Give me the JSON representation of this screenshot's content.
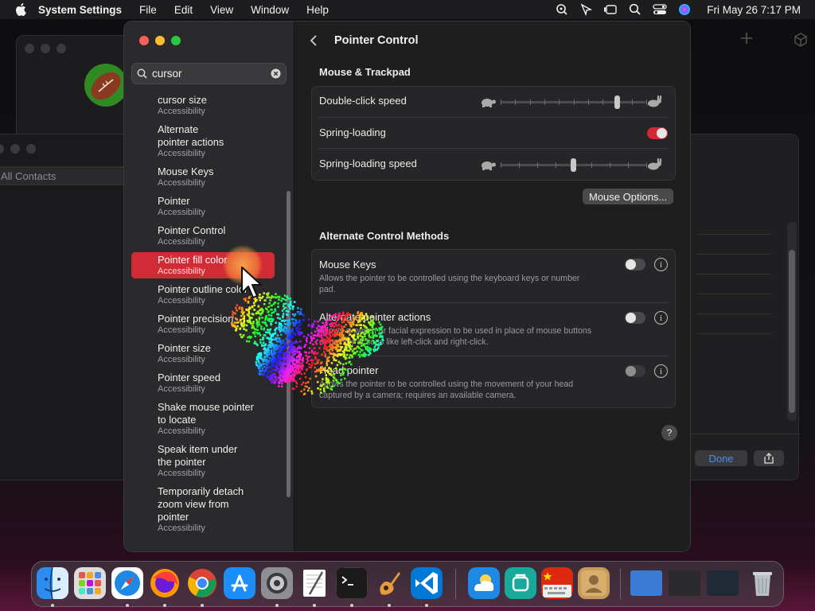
{
  "menubar": {
    "app": "System Settings",
    "menus": [
      "File",
      "Edit",
      "View",
      "Window",
      "Help"
    ],
    "clock": "Fri May 26  7:17 PM"
  },
  "background": {
    "contacts_label": "All Contacts",
    "done_label": "Done"
  },
  "search": {
    "value": "cursor",
    "placeholder": "Search"
  },
  "results": [
    {
      "title": [
        "cursor size"
      ],
      "sub": "Accessibility"
    },
    {
      "title": [
        "Alternate",
        "pointer actions"
      ],
      "sub": "Accessibility"
    },
    {
      "title": [
        "Mouse Keys"
      ],
      "sub": "Accessibility"
    },
    {
      "title": [
        "Pointer"
      ],
      "sub": "Accessibility"
    },
    {
      "title": [
        "Pointer Control"
      ],
      "sub": "Accessibility"
    },
    {
      "title": [
        "Pointer fill color"
      ],
      "sub": "Accessibility",
      "selected": true
    },
    {
      "title": [
        "Pointer outline color"
      ],
      "sub": "Accessibility"
    },
    {
      "title": [
        "Pointer precision"
      ],
      "sub": "Accessibility"
    },
    {
      "title": [
        "Pointer size"
      ],
      "sub": "Accessibility"
    },
    {
      "title": [
        "Pointer speed"
      ],
      "sub": "Accessibility"
    },
    {
      "title": [
        "Shake mouse pointer",
        "to locate"
      ],
      "sub": "Accessibility"
    },
    {
      "title": [
        "Speak item under",
        "the pointer"
      ],
      "sub": "Accessibility"
    },
    {
      "title": [
        "Temporarily detach",
        "zoom view from",
        "pointer"
      ],
      "sub": "Accessibility"
    }
  ],
  "content": {
    "title": "Pointer Control",
    "mouse_trackpad": {
      "heading": "Mouse & Trackpad",
      "double_click_speed": {
        "label": "Double-click speed",
        "value": 0.8
      },
      "spring_loading": {
        "label": "Spring-loading",
        "on": true
      },
      "spring_loading_speed": {
        "label": "Spring-loading speed",
        "value": 0.5
      },
      "mouse_options_button": "Mouse Options..."
    },
    "alternate": {
      "heading": "Alternate Control Methods",
      "mouse_keys": {
        "label": "Mouse Keys",
        "desc": "Allows the pointer to be controlled using the keyboard keys or number pad.",
        "on": false
      },
      "alt_pointer": {
        "label": "Alternate pointer actions",
        "desc": "Allows a switch or facial expression to be used in place of mouse buttons or pointer actions like left-click and right-click.",
        "on": false
      },
      "head_pointer": {
        "label": "Head pointer",
        "desc": "Allows the pointer to be controlled using the movement of your head captured by a camera; requires an available camera.",
        "on": false
      }
    },
    "help_label": "?"
  },
  "dock": {
    "apps": [
      "Finder",
      "Launchpad",
      "Safari",
      "Firefox",
      "Chrome",
      "App Store",
      "System Settings",
      "TextEdit",
      "Terminal",
      "GarageBand",
      "Visual Studio Code",
      "Weather",
      "Maps",
      "Keyboard Viewer",
      "Contacts"
    ],
    "trash": "Trash"
  },
  "colors": {
    "accent": "#d22b35",
    "sidebar": "#2a2a2c",
    "content": "#1e1e1e"
  }
}
